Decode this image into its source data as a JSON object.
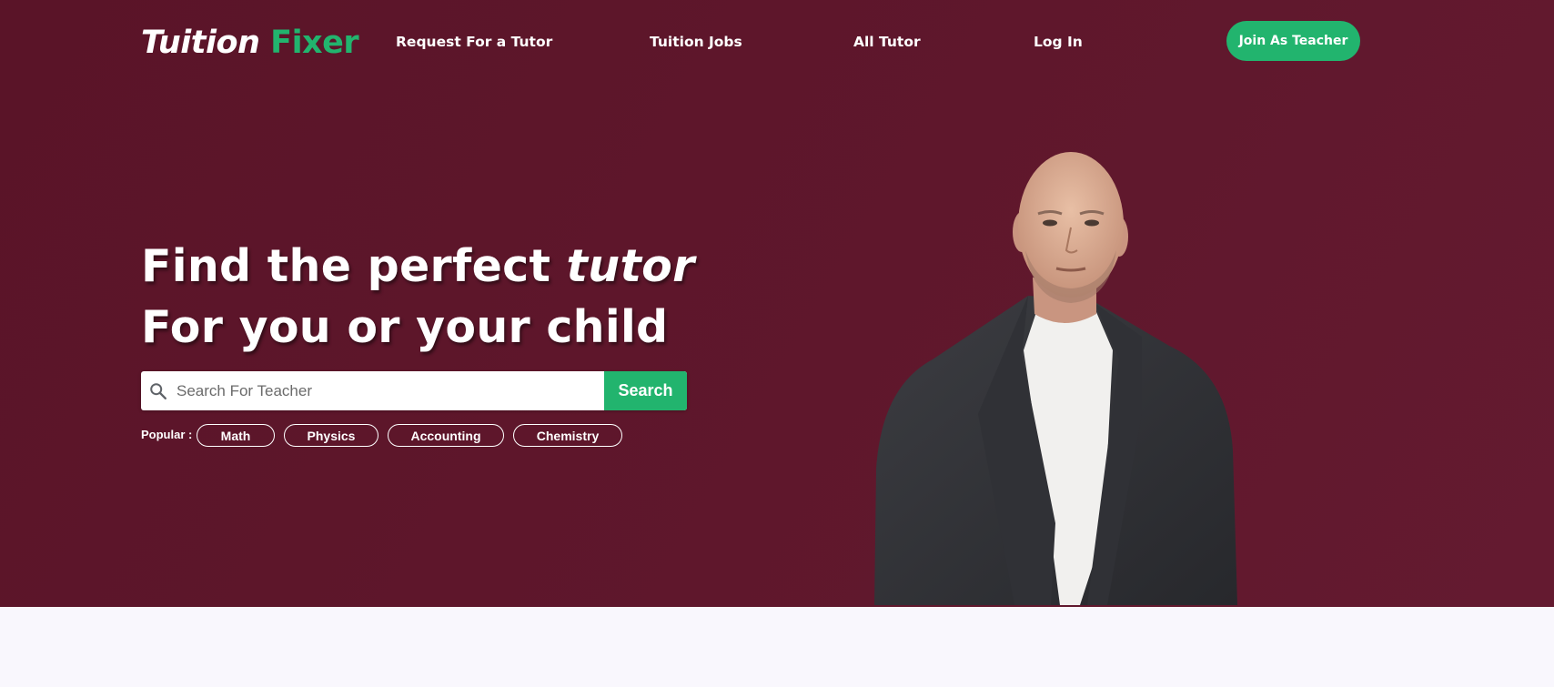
{
  "brand": {
    "name_part1": "Tuition",
    "name_part2": "Fixer",
    "accent_color": "#22b46e",
    "hero_color": "#5e162b"
  },
  "nav": {
    "links": [
      {
        "label": "Request For a Tutor"
      },
      {
        "label": "Tuition Jobs"
      },
      {
        "label": "All Tutor"
      },
      {
        "label": "Log In"
      }
    ],
    "cta_label": "Join As Teacher"
  },
  "hero": {
    "line1_text": "Find the perfect ",
    "line1_emphasis": "tutor",
    "line2_text": "For you or your child",
    "search": {
      "placeholder": "Search For Teacher",
      "value": "",
      "button_label": "Search",
      "icon": "search-icon"
    },
    "popular": {
      "label": "Popular :",
      "tags": [
        "Math",
        "Physics",
        "Accounting",
        "Chemistry"
      ]
    },
    "image": "tutor-portrait"
  }
}
